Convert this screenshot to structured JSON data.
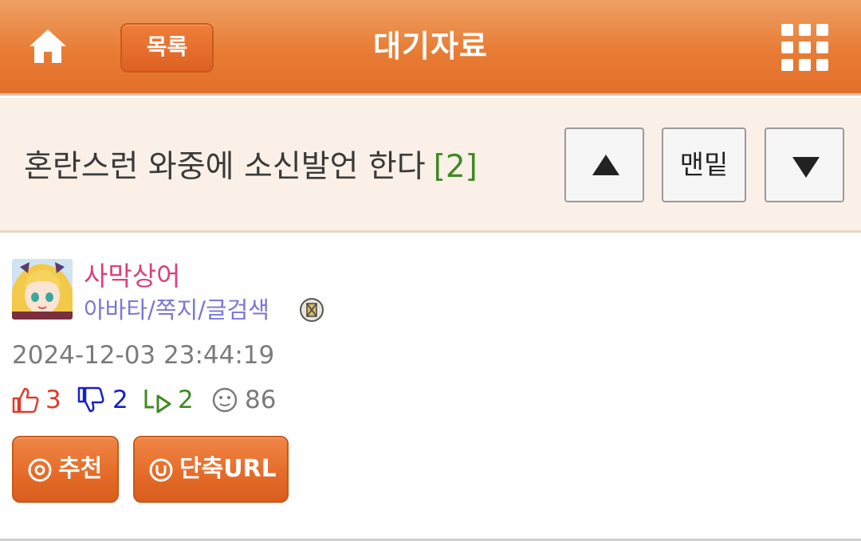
{
  "header": {
    "title": "대기자료",
    "list_button_label": "목록",
    "home_icon": "home-icon",
    "menu_icon": "grid-menu-icon",
    "accent_color": "#e87c35"
  },
  "post": {
    "title": "혼란스런 와중에 소신발언 한다",
    "comment_count": "[2]",
    "nav": {
      "up_icon": "triangle-up-icon",
      "bottom_label": "맨밑",
      "down_icon": "triangle-down-icon"
    }
  },
  "author": {
    "name": "사막상어",
    "links": "아바타/쪽지/글검색",
    "badge_icon": "level-badge-icon",
    "avatar": "avatar-image"
  },
  "meta": {
    "date": "2024-12-03 23:44:19",
    "likes": "3",
    "dislikes": "2",
    "replies": "2",
    "views": "86",
    "colors": {
      "likes": "#e03a2a",
      "dislikes": "#1520c8",
      "replies": "#3f8a22",
      "views": "#7b7b7b"
    }
  },
  "actions": {
    "recommend_label": "추천",
    "shorturl_label": "단축URL"
  }
}
